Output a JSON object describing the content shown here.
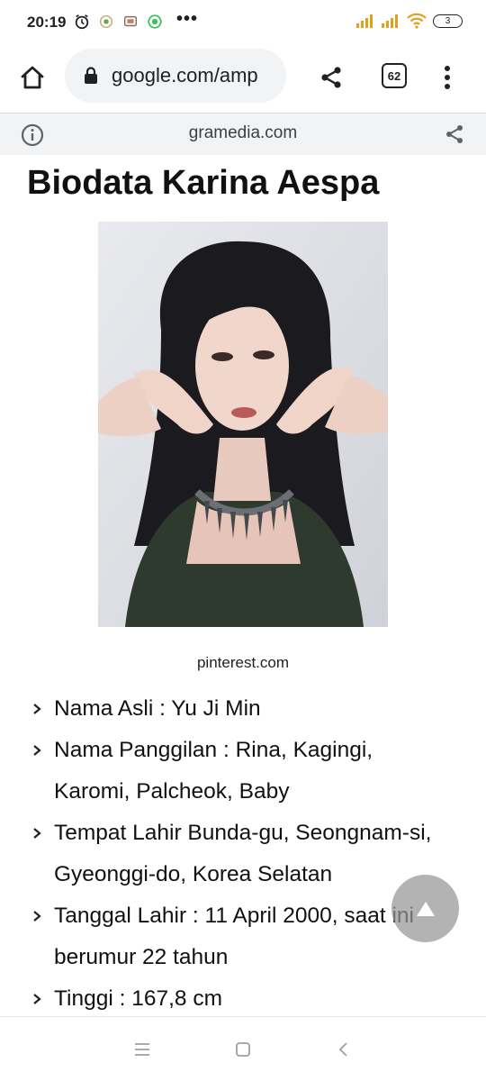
{
  "status_bar": {
    "time": "20:19",
    "notification_icons": [
      "alarm-icon",
      "app-notification-icon",
      "message-icon",
      "whatsapp-icon"
    ],
    "overflow": "•••",
    "battery_level": "3"
  },
  "browser": {
    "url": "google.com/amp",
    "tab_count": "62"
  },
  "amp_header": {
    "domain": "gramedia.com"
  },
  "article": {
    "title": "Biodata Karina Aespa",
    "image_caption": "pinterest.com",
    "bio_items": [
      "Nama Asli : Yu Ji Min",
      "Nama Panggilan : Rina, Kagingi, Karomi, Palcheok, Baby",
      "Tempat Lahir Bunda-gu, Seongnam-si, Gyeonggi-do, Korea Selatan",
      "Tanggal Lahir : 11 April 2000, saat ini berumur 22 tahun",
      "Tinggi : 167,8 cm"
    ]
  },
  "colors": {
    "url_bar_bg": "#f1f3f4",
    "amp_header_bg": "#f1f3f4",
    "signal": "#e0a21c"
  }
}
